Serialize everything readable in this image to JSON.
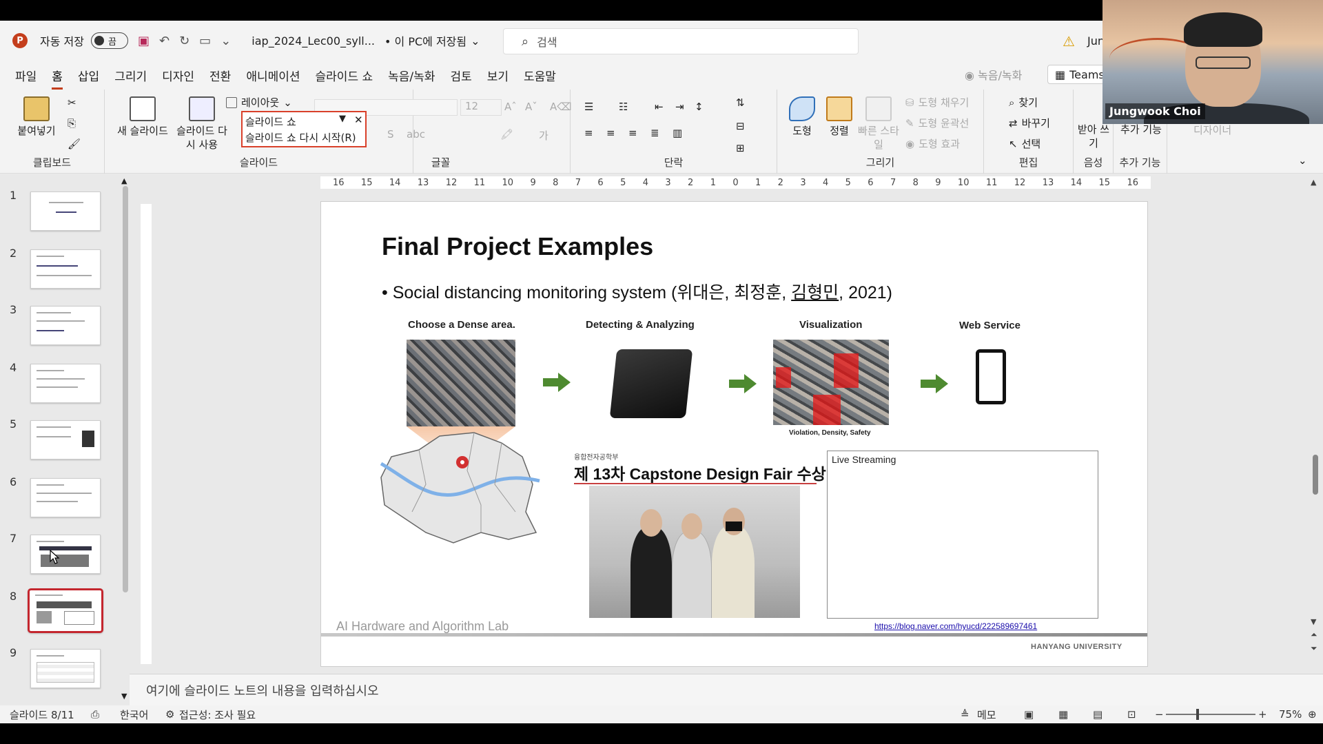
{
  "titlebar": {
    "app_logo": "P",
    "autosave_label": "자동 저장",
    "autosave_state": "끔",
    "filename": "iap_2024_Lec00_syll...",
    "save_location": "• 이 PC에 저장됨",
    "search_placeholder": "검색",
    "user_short": "Jun"
  },
  "menu": {
    "tabs": [
      "파일",
      "홈",
      "삽입",
      "그리기",
      "디자인",
      "전환",
      "애니메이션",
      "슬라이드 쇼",
      "녹음/녹화",
      "검토",
      "보기",
      "도움말"
    ],
    "active_tab": "홈",
    "record_button": "◉ 녹음/녹화",
    "teams_button": "Teams"
  },
  "ribbon": {
    "clipboard": {
      "paste": "붙여넣기",
      "label": "클립보드"
    },
    "slides": {
      "new_slide": "새 슬라이드",
      "reuse_slide": "슬라이드 다시 사용",
      "layout": "레이아웃",
      "label": "슬라이드"
    },
    "font": {
      "size": "12",
      "label": "글꼴"
    },
    "paragraph": {
      "label": "단락"
    },
    "drawing": {
      "shape": "도형",
      "arrange": "정렬",
      "quick_style": "빠른 스타일",
      "fill": "도형 채우기",
      "outline": "도형 윤곽선",
      "effects": "도형 효과",
      "label": "그리기"
    },
    "editing": {
      "find": "찾기",
      "replace": "바꾸기",
      "select": "선택",
      "label": "편집"
    },
    "voice": {
      "dictate": "받아 쓰기",
      "label": "음성"
    },
    "addins": {
      "addins": "추가 기능",
      "label": "추가 기능"
    },
    "designer": "디자이너"
  },
  "popup": {
    "item1": "슬라이드 쇼",
    "item2": "슬라이드 쇼 다시 시작(R)"
  },
  "webcam": {
    "name": "Jungwook Choi"
  },
  "thumbnails": {
    "numbers": [
      "1",
      "2",
      "3",
      "4",
      "5",
      "6",
      "7",
      "8",
      "9"
    ],
    "selected": 8
  },
  "ruler": {
    "h_ticks": [
      "16",
      "15",
      "14",
      "13",
      "12",
      "11",
      "10",
      "9",
      "8",
      "7",
      "6",
      "5",
      "4",
      "3",
      "2",
      "1",
      "0",
      "1",
      "2",
      "3",
      "4",
      "5",
      "6",
      "7",
      "8",
      "9",
      "10",
      "11",
      "12",
      "13",
      "14",
      "15",
      "16"
    ]
  },
  "slide": {
    "title": "Final Project Examples",
    "bullet_prefix": "• Social distancing monitoring system (위대은, 최정훈, ",
    "bullet_underlined": "김형민",
    "bullet_suffix": ", 2021)",
    "steps": [
      "Choose a Dense area.",
      "Detecting & Analyzing",
      "Visualization",
      "Web Service"
    ],
    "vis_caption": "Violation, Density, Safety",
    "banner_small": "융합전자공학부",
    "banner_title": "제 13차 Capstone Design Fair 수상",
    "live_label": "Live Streaming",
    "link": "https://blog.naver.com/hyucd/222589697461",
    "lab_footer": "AI Hardware and Algorithm Lab",
    "university": "HANYANG UNIVERSITY"
  },
  "notes": {
    "placeholder": "여기에 슬라이드 노트의 내용을 입력하십시오"
  },
  "status": {
    "slide_pos": "슬라이드 8/11",
    "language": "한국어",
    "accessibility": "접근성: 조사 필요",
    "notes_btn": "메모",
    "zoom": "75%"
  }
}
